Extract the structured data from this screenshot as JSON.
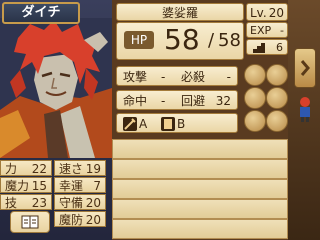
{
  "unit": {
    "name": "ダイチ",
    "class": "婆娑羅",
    "level_label": "Lv.",
    "level": "20",
    "hp_label": "HP",
    "hp_current": "58",
    "hp_max": "58",
    "hp_separator": "/",
    "exp_label": "EXP",
    "exp_value": "-",
    "move_value": "6"
  },
  "combat": {
    "attack_label": "攻撃",
    "attack_value": "-",
    "crit_label": "必殺",
    "crit_value": "-",
    "hit_label": "命中",
    "hit_value": "-",
    "avoid_label": "回避",
    "avoid_value": "32"
  },
  "weapon_ranks": [
    {
      "icon": "sword-icon",
      "rank": "A"
    },
    {
      "icon": "tome-icon",
      "rank": "B"
    }
  ],
  "stats": {
    "str_label": "力",
    "str": "22",
    "spd_label": "速さ",
    "spd": "19",
    "mag_label": "魔力",
    "mag": "15",
    "lck_label": "幸運",
    "lck": "7",
    "skl_label": "技",
    "skl": "23",
    "def_label": "守備",
    "def": "20",
    "res_label": "魔防",
    "res": "20"
  },
  "colors": {
    "frame": "#c79b4b",
    "panel": "#5a3b20",
    "cream": "#f0e0b5",
    "text": "#3b2610"
  }
}
